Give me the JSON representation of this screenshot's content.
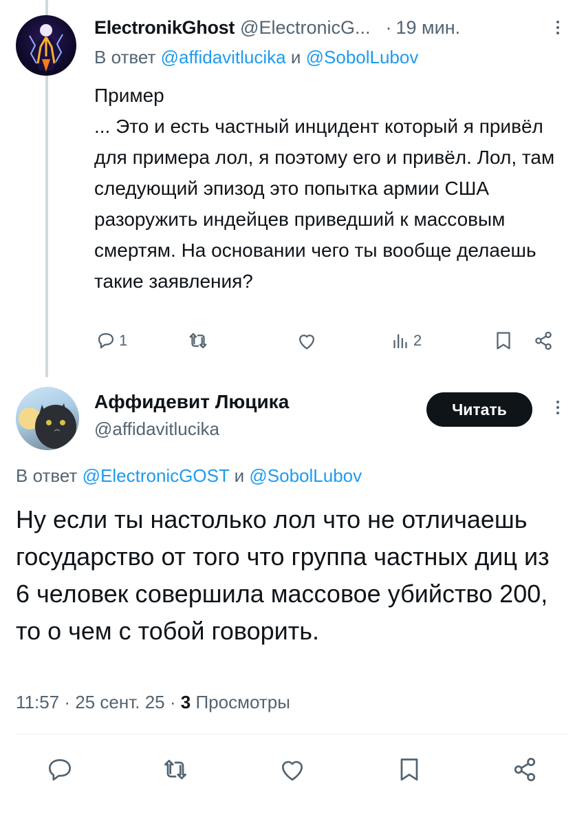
{
  "reply": {
    "display_name": "ElectronikGhost",
    "handle": "@ElectronicG...",
    "time_separator": "·",
    "time": "19 мин.",
    "reply_to_prefix": "В ответ",
    "reply_to_mention_1": "@affidavitlucika",
    "reply_to_conj": "и",
    "reply_to_mention_2": "@SobolLubov",
    "text_line_1": "Пример",
    "text_body": "... Это и есть частный инцидент который я привёл для примера лол, я поэтому его и привёл. Лол, там следующий эпизод это попытка армии США разоружить индейцев приведший к массовым смертям. На основании чего ты вообще делаешь такие заявления?",
    "reply_count": "1",
    "views_count": "2"
  },
  "main": {
    "display_name": "Аффидевит Люцика",
    "handle": "@affidavitlucika",
    "follow_label": "Читать",
    "reply_to_prefix": "В ответ",
    "reply_to_mention_1": "@ElectronicGOST",
    "reply_to_conj": "и",
    "reply_to_mention_2": "@SobolLubov",
    "text": "Ну если ты настолько лол что не отличаешь государство от того что группа частных диц из 6 человек совершила массовое убийство 200, то о чем с тобой говорить.",
    "time": "11:57",
    "date": "25 сент. 25",
    "sep": "·",
    "views_count": "3",
    "views_label": "Просмотры"
  },
  "icons": {
    "reply": "reply-icon",
    "repost": "repost-icon",
    "like": "like-icon",
    "views": "views-icon",
    "bookmark": "bookmark-icon",
    "share": "share-icon",
    "more": "more-icon"
  },
  "colors": {
    "text_primary": "#0f1419",
    "text_secondary": "#536471",
    "link": "#1d9bf0",
    "thread_line": "#cfd9de",
    "follow_bg": "#0f1419"
  }
}
